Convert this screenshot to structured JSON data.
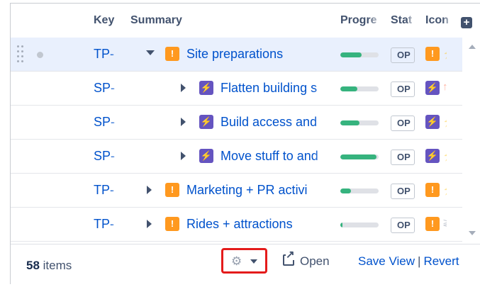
{
  "header": {
    "key": "Key",
    "summary": "Summary",
    "progress": "Progre",
    "status": "Stat",
    "icons": "Icon",
    "add_column_icon": "plus-square-icon"
  },
  "rows": [
    {
      "key": "TP-",
      "summary": "Site preparations",
      "type_icon": "idea-bulb-icon",
      "type_color": "#ff991f",
      "expanded": true,
      "progress": 0.55,
      "status": "OP",
      "selected": true
    },
    {
      "key": "SP-",
      "summary": "Flatten building s",
      "type_icon": "lightning-icon",
      "type_color": "#6554c0",
      "expanded": false,
      "progress": 0.45,
      "status": "OP",
      "selected": false
    },
    {
      "key": "SP-",
      "summary": "Build access and",
      "type_icon": "lightning-icon",
      "type_color": "#6554c0",
      "expanded": false,
      "progress": 0.5,
      "status": "OP",
      "selected": false
    },
    {
      "key": "SP-",
      "summary": "Move stuff to and",
      "type_icon": "lightning-icon",
      "type_color": "#6554c0",
      "expanded": false,
      "progress": 0.95,
      "status": "OP",
      "selected": false
    },
    {
      "key": "TP-",
      "summary": "Marketing + PR activi",
      "type_icon": "idea-bulb-icon",
      "type_color": "#ff991f",
      "expanded": false,
      "progress": 0.28,
      "status": "OP",
      "selected": false
    },
    {
      "key": "TP-",
      "summary": "Rides + attractions",
      "type_icon": "idea-bulb-icon",
      "type_color": "#ff991f",
      "expanded": false,
      "progress": 0.06,
      "status": "OP",
      "selected": false
    }
  ],
  "footer": {
    "count": "58",
    "count_suffix": " items",
    "open_label": "Open",
    "save_view": "Save View",
    "separator": "|",
    "revert": "Revert"
  }
}
